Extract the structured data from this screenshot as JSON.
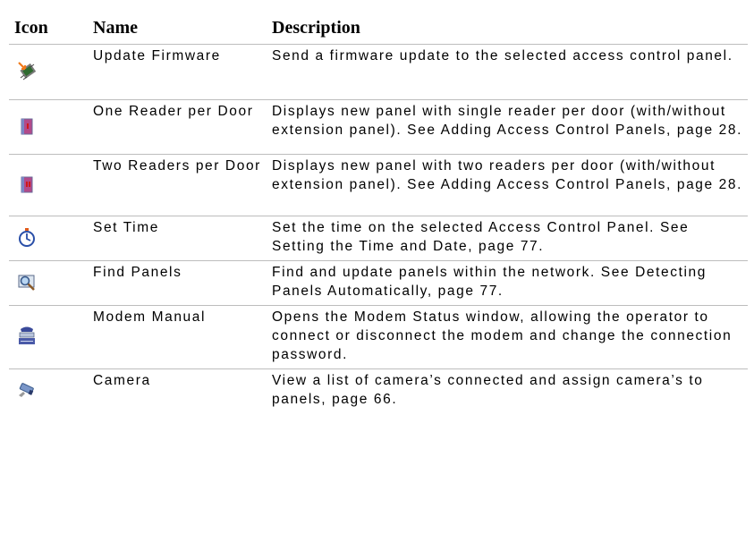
{
  "columns": [
    "Icon",
    "Name",
    "Description"
  ],
  "rows": [
    {
      "icon": "update-firmware-icon",
      "name": "Update Firmware",
      "description": "Send a firmware update to the selected access control panel."
    },
    {
      "icon": "one-reader-per-door-icon",
      "name": "One Reader per Door",
      "description": "Displays new panel with single reader per door (with/without extension panel). See Adding Access Control Panels, page 28."
    },
    {
      "icon": "two-readers-per-door-icon",
      "name": "Two Readers per Door",
      "description": "Displays new panel with two readers per door (with/without extension panel).  See Adding Access Control Panels, page 28."
    },
    {
      "icon": "set-time-icon",
      "name": "Set Time",
      "description": "Set the time on the selected Access Control Panel. See Setting the Time and Date, page 77."
    },
    {
      "icon": "find-panels-icon",
      "name": "Find Panels",
      "description": "Find and update panels within the network. See Detecting Panels Automatically, page 77."
    },
    {
      "icon": "modem-manual-icon",
      "name": "Modem Manual",
      "description": "Opens the Modem Status window, allowing the operator to connect or disconnect the modem and change the connection password."
    },
    {
      "icon": "camera-icon",
      "name": "Camera",
      "description": "View a list of camera’s connected and assign camera’s to panels, page 66."
    }
  ]
}
